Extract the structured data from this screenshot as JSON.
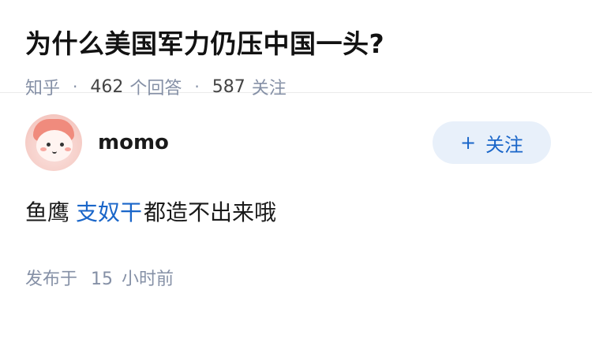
{
  "question": {
    "title": "为什么美国军力仍压中国一头?",
    "source": "知乎",
    "answer_count": "462",
    "answer_label": "个回答",
    "follower_count": "587",
    "follower_label": "关注",
    "separator": "·"
  },
  "answer": {
    "author_name": "momo",
    "follow_plus": "+",
    "follow_label": "关注",
    "content_before": "鱼鹰",
    "content_link": "支奴干",
    "content_after": "都造不出来哦",
    "published_prefix": "发布于",
    "published_num": "15",
    "published_suffix": "小时前"
  },
  "colors": {
    "accent": "#1a66c9",
    "meta": "#8590a6",
    "button_bg": "#e8f0fa"
  }
}
